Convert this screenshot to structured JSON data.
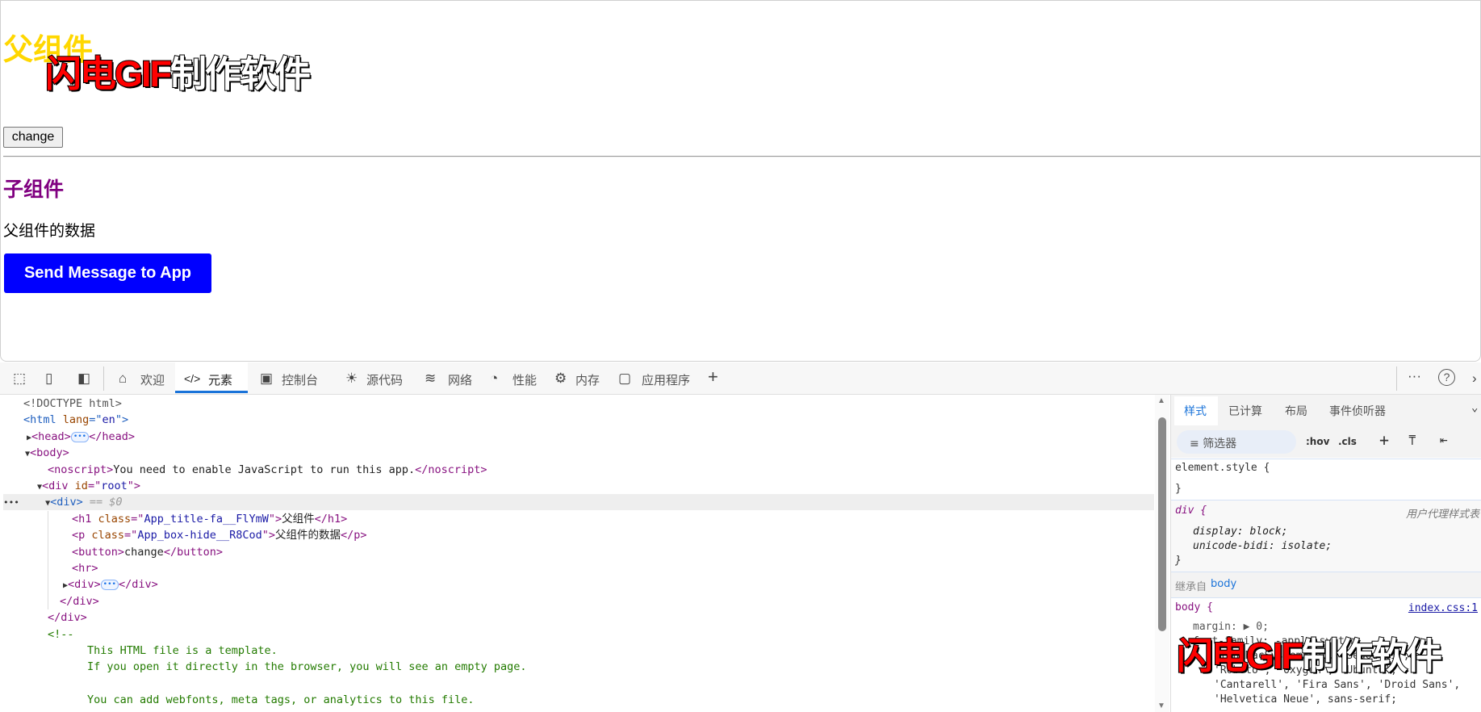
{
  "page": {
    "parent_title": "父组件",
    "watermark": {
      "red": "闪电GIF",
      "white": "制作软件"
    },
    "change_button": "change",
    "child_title": "子组件",
    "parent_data": "父组件的数据",
    "send_button": "Send Message to App",
    "colors": {
      "parent_title": "#FFD700",
      "child_title": "#800080",
      "send_button": "#0000FF"
    }
  },
  "devtools": {
    "tabs": [
      {
        "label": "欢迎",
        "icon": "home-icon"
      },
      {
        "label": "元素",
        "icon": "code-icon",
        "active": true
      },
      {
        "label": "控制台",
        "icon": "console-icon"
      },
      {
        "label": "源代码",
        "icon": "bug-icon"
      },
      {
        "label": "网络",
        "icon": "wifi-icon"
      },
      {
        "label": "性能",
        "icon": "gauge-icon"
      },
      {
        "label": "内存",
        "icon": "chip-icon"
      },
      {
        "label": "应用程序",
        "icon": "window-icon"
      }
    ],
    "add_tab": "+",
    "more": "···",
    "help": "?",
    "elements": {
      "doctype": "<!DOCTYPE html>",
      "html_open": [
        "<html",
        " lang",
        "=\"",
        "en",
        "\">"
      ],
      "head": [
        "<head>",
        "</head>"
      ],
      "body": "<body>",
      "noscript": [
        "<noscript>",
        "You need to enable JavaScript to run this app.",
        "</noscript>"
      ],
      "root": [
        "<div",
        " id",
        "=\"",
        "root",
        "\">"
      ],
      "selected": [
        "<div>",
        " == $0"
      ],
      "h1": [
        "<h1",
        " class",
        "=\"",
        "App_title-fa__FlYmW",
        "\">",
        "父组件",
        "</h1>"
      ],
      "p": [
        "<p",
        " class",
        "=\"",
        "App_box-hide__R8Cod",
        "\">",
        "父组件的数据",
        "</p>"
      ],
      "button": [
        "<button>",
        "change",
        "</button>"
      ],
      "hr": "<hr>",
      "child_div": [
        "<div>",
        "</div>"
      ],
      "close_div": "</div>",
      "comment_open": "<!--",
      "comment_lines": [
        "This HTML file is a template.",
        "If you open it directly in the browser, you will see an empty page.",
        "You can add webfonts, meta tags, or analytics to this file."
      ]
    },
    "styles": {
      "tabs": [
        "样式",
        "已计算",
        "布局",
        "事件侦听器"
      ],
      "filter_placeholder": "筛选器",
      "hov": ":hov",
      "cls": ".cls",
      "element_style": "element.style {",
      "close": "}",
      "div_rule": "div {",
      "ua_label": "用户代理样式表",
      "div_props": [
        "display: block;",
        "unicode-bidi: isolate;"
      ],
      "inherited_label": "继承自",
      "inherited_from": "body",
      "body_rule": "body {",
      "body_source": "index.css:1",
      "body_lines": [
        "margin: ▶ 0;",
        "font-family: -apple-system,",
        "BlinkMacSystemFont, 'Segoe UI',",
        "'Roboto', 'Oxygen', 'Ubuntu',",
        "'Cantarell', 'Fira Sans', 'Droid Sans',",
        "'Helvetica Neue', sans-serif;"
      ]
    }
  }
}
